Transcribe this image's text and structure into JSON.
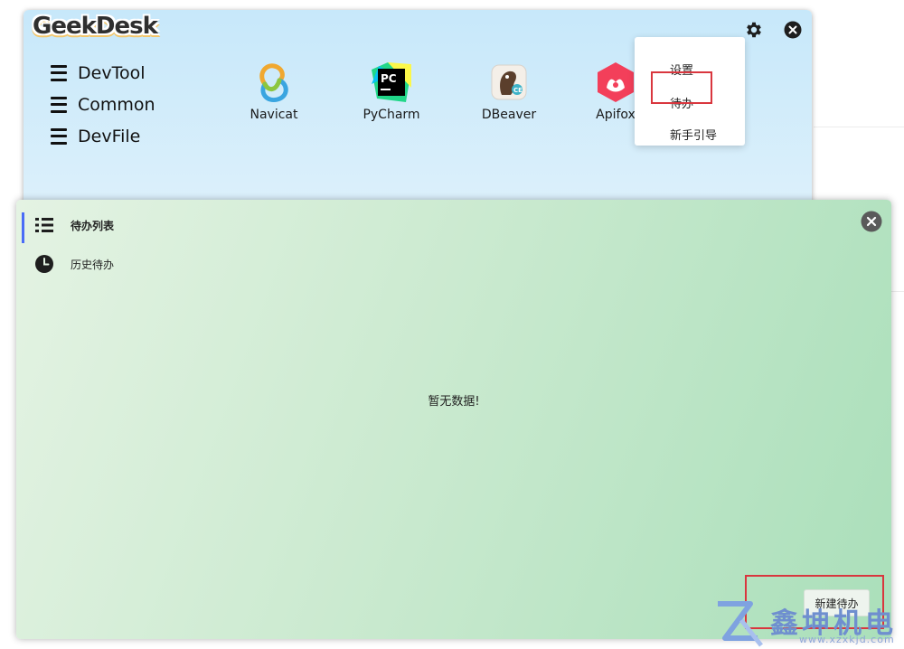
{
  "main_window": {
    "logo_text": "GeekDesk",
    "menu": [
      {
        "label": "DevTool"
      },
      {
        "label": "Common"
      },
      {
        "label": "DevFile"
      }
    ],
    "apps": [
      {
        "label": "Navicat",
        "icon": "navicat-icon"
      },
      {
        "label": "PyCharm",
        "icon": "pycharm-icon"
      },
      {
        "label": "DBeaver",
        "icon": "dbeaver-icon"
      },
      {
        "label": "Apifox",
        "icon": "apifox-icon"
      }
    ],
    "settings_dropdown": {
      "items": [
        {
          "label": "设置"
        },
        {
          "label": "待办"
        },
        {
          "label": "新手引导"
        }
      ]
    }
  },
  "todo_window": {
    "nav": [
      {
        "label": "待办列表",
        "icon": "list-icon",
        "active": true
      },
      {
        "label": "历史待办",
        "icon": "clock-icon",
        "active": false
      }
    ],
    "empty_message": "暂无数据!",
    "new_button_label": "新建待办"
  },
  "watermark": {
    "brand": "鑫坤机电",
    "url": "www.xzxkjd.com"
  },
  "colors": {
    "highlight_box": "#d9363e",
    "active_accent": "#4a6cf7"
  }
}
